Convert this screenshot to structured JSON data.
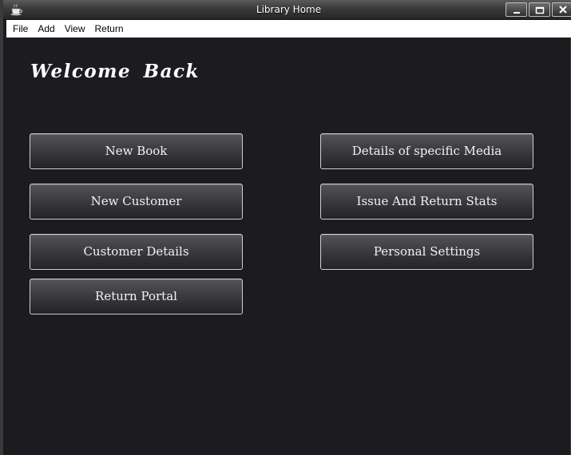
{
  "window": {
    "title": "Library Home"
  },
  "menu": {
    "items": [
      {
        "label": "File"
      },
      {
        "label": "Add"
      },
      {
        "label": "View"
      },
      {
        "label": "Return"
      }
    ]
  },
  "main": {
    "heading": "Welcome Back",
    "buttons": {
      "new_book": "New Book",
      "new_customer": "New Customer",
      "customer_details": "Customer Details",
      "return_portal": "Return Portal",
      "media_details": "Details of specific Media",
      "issue_return_stats": "Issue And Return Stats",
      "personal_settings": "Personal Settings"
    }
  },
  "colors": {
    "background": "#1c1b20",
    "button_border": "#cfcfcf",
    "text": "#ffffff"
  },
  "icons": {
    "app": "coffee-cup-icon",
    "minimize": "minimize-icon",
    "maximize": "maximize-icon",
    "close": "close-icon"
  }
}
